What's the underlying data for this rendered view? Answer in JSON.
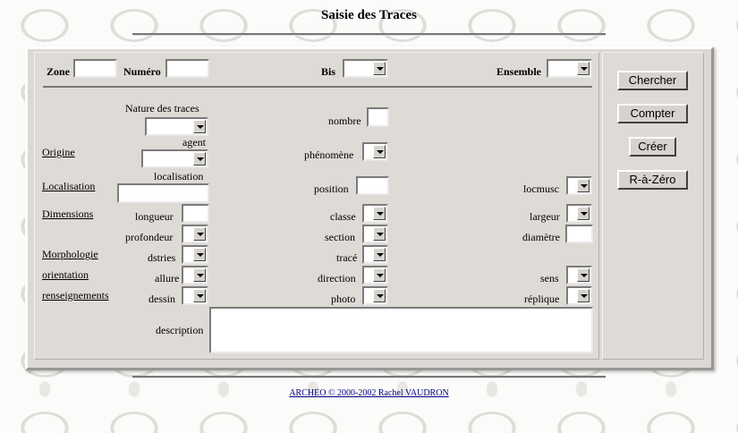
{
  "title": "Saisie des Traces",
  "top_fields": {
    "zone_label": "Zone",
    "numero_label": "Numéro",
    "bis_label": "Bis",
    "ensemble_label": "Ensemble"
  },
  "sections": {
    "origine": "Origine",
    "localisation": "Localisation",
    "dimensions": "Dimensions",
    "morphologie": "Morphologie",
    "orientation": "orientation",
    "renseignements": "renseignements"
  },
  "fields": {
    "nature_des_traces": "Nature des traces",
    "agent": "agent",
    "localisation": "localisation",
    "nombre": "nombre",
    "phenomene": "phénomène",
    "position": "position",
    "locmusc": "locmusc",
    "longueur": "longueur",
    "classe": "classe",
    "largeur": "largeur",
    "profondeur": "profondeur",
    "section": "section",
    "diametre": "diamètre",
    "dstries": "dstries",
    "trace": "tracé",
    "allure": "allure",
    "direction": "direction",
    "sens": "sens",
    "dessin": "dessin",
    "photo": "photo",
    "replique": "réplique",
    "description": "description"
  },
  "buttons": {
    "chercher": "Chercher",
    "compter": "Compter",
    "creer": "Créer",
    "raz": "R-à-Zéro"
  },
  "footer": "ARCHEO © 2000-2002 Rachel VAUDRON",
  "colors": {
    "panel": "#dcd8d3",
    "link": "#000080"
  }
}
